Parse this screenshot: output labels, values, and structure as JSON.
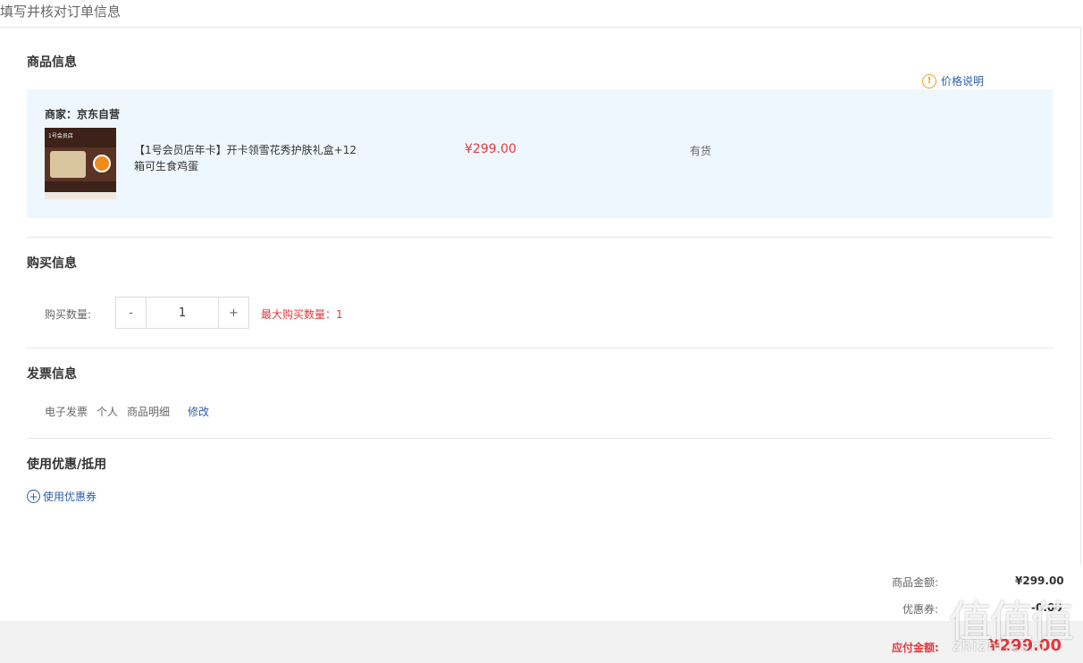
{
  "page": {
    "title": "填写并核对订单信息"
  },
  "product_section": {
    "title": "商品信息",
    "price_note": "价格说明",
    "price_note_icon": "warning-circle-icon",
    "merchant": "商家：京东自营",
    "product": {
      "name": "【1号会员店年卡】开卡领雪花秀护肤礼盒+12箱可生食鸡蛋",
      "price": "¥299.00",
      "stock": "有货"
    }
  },
  "purchase_section": {
    "title": "购买信息",
    "quantity_label": "购买数量:",
    "minus": "-",
    "quantity": "1",
    "plus": "+",
    "max_quantity": "最大购买数量：1"
  },
  "invoice_section": {
    "title": "发票信息",
    "type": "电子发票",
    "holder": "个人",
    "content": "商品明细",
    "edit": "修改"
  },
  "coupon_section": {
    "title": "使用优惠/抵用",
    "use_coupon": "使用优惠券",
    "icon": "plus-circle-icon"
  },
  "summary": {
    "goods_amount_label": "商品金额:",
    "goods_amount": "¥299.00",
    "coupon_label": "优惠券:",
    "coupon_amount": "-0.00",
    "payable_label": "应付金额:",
    "payable_amount": "¥299.00"
  },
  "watermark": {
    "logo": "值值值",
    "url": "zhizhi.com"
  },
  "colors": {
    "accent_red": "#e4393c",
    "link_blue": "#2e5fa8",
    "product_bg": "#eef7fd",
    "warning": "#f0a020"
  }
}
